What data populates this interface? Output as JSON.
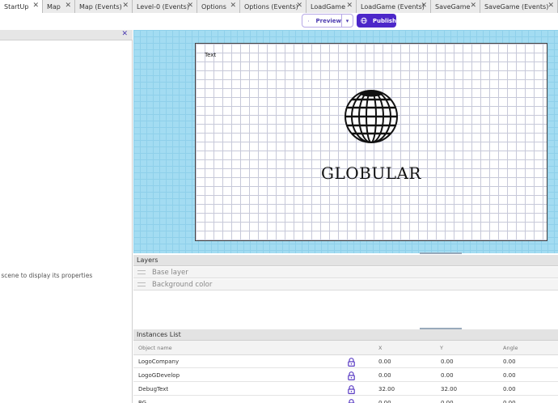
{
  "tabs": [
    {
      "label": "StartUp",
      "active": true
    },
    {
      "label": "Map"
    },
    {
      "label": "Map (Events)"
    },
    {
      "label": "Level-0 (Events)"
    },
    {
      "label": "Options"
    },
    {
      "label": "Options (Events)"
    },
    {
      "label": "LoadGame"
    },
    {
      "label": "LoadGame (Events)"
    },
    {
      "label": "SaveGame"
    },
    {
      "label": "SaveGame (Events)"
    }
  ],
  "toolbar": {
    "preview_label": "Preview",
    "publish_label": "Publish"
  },
  "properties": {
    "hint": "istance in the scene to display its properties"
  },
  "scene": {
    "debug_text": "Text",
    "logo_word": "GLOBULAR"
  },
  "layers": {
    "title": "Layers",
    "items": [
      {
        "label": "Base layer"
      },
      {
        "label": "Background color"
      }
    ]
  },
  "instances": {
    "title": "Instances List",
    "columns": {
      "name": "Object name",
      "x": "X",
      "y": "Y",
      "angle": "Angle"
    },
    "rows": [
      {
        "name": "LogoCompany",
        "x": "0.00",
        "y": "0.00",
        "angle": "0.00"
      },
      {
        "name": "LogoGDevelop",
        "x": "0.00",
        "y": "0.00",
        "angle": "0.00"
      },
      {
        "name": "DebugText",
        "x": "32.00",
        "y": "32.00",
        "angle": "0.00"
      },
      {
        "name": "BG",
        "x": "0.00",
        "y": "0.00",
        "angle": "0.00"
      }
    ]
  },
  "colors": {
    "accent": "#4c27c9",
    "scene_bg": "#a3dcf2"
  }
}
